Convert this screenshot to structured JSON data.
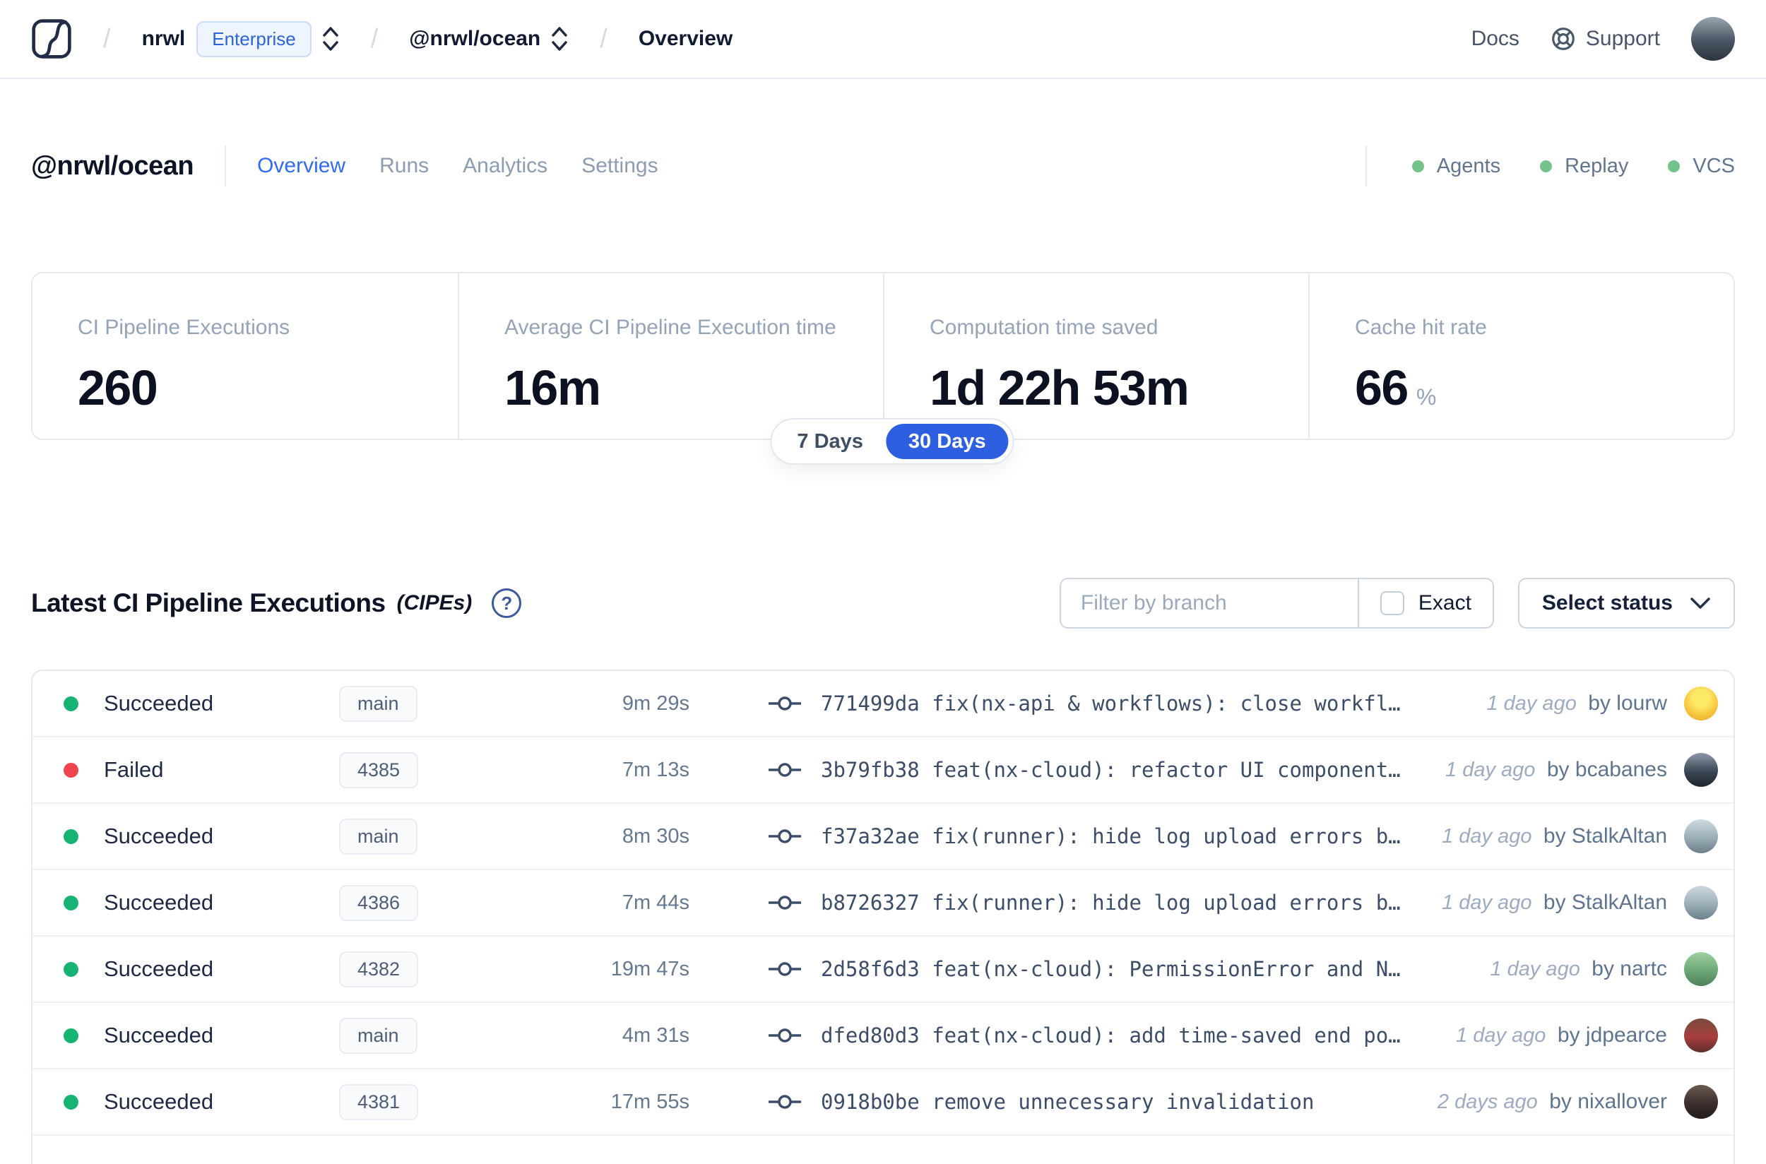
{
  "colors": {
    "accent_blue": "#2e5fe0",
    "success_green": "#16b374",
    "failed_red": "#f2444d",
    "feature_dot_green": "#74c38b"
  },
  "nav": {
    "separator": "/",
    "org": "nrwl",
    "org_badge": "Enterprise",
    "workspace": "@nrwl/ocean",
    "page": "Overview",
    "docs_label": "Docs",
    "support_label": "Support",
    "avatar_bg": "linear-gradient(180deg,#9aa5b1,#4a5563 55%,#2c343f)"
  },
  "workspace": {
    "title": "@nrwl/ocean",
    "tabs": [
      {
        "label": "Overview",
        "active": true
      },
      {
        "label": "Runs",
        "active": false
      },
      {
        "label": "Analytics",
        "active": false
      },
      {
        "label": "Settings",
        "active": false
      }
    ],
    "features": [
      {
        "label": "Agents",
        "dot_color": "#74c38b"
      },
      {
        "label": "Replay",
        "dot_color": "#74c38b"
      },
      {
        "label": "VCS",
        "dot_color": "#74c38b"
      }
    ]
  },
  "stats": {
    "cards": [
      {
        "label": "CI Pipeline Executions",
        "value": "260"
      },
      {
        "label": "Average CI Pipeline Execution time",
        "value": "16m"
      },
      {
        "label": "Computation time saved",
        "value": "1d 22h 53m"
      },
      {
        "label": "Cache hit rate",
        "value": "66",
        "suffix": "%"
      }
    ],
    "range_options": [
      {
        "label": "7 Days",
        "selected": false
      },
      {
        "label": "30 Days",
        "selected": true
      }
    ]
  },
  "cipes": {
    "title": "Latest CI Pipeline Executions",
    "title_suffix": "(CIPEs)",
    "help_glyph": "?",
    "filter": {
      "branch_placeholder": "Filter by branch",
      "exact_label": "Exact",
      "status_button_label": "Select status"
    },
    "rows": [
      {
        "status": "Succeeded",
        "status_color": "#16b374",
        "branch": "main",
        "duration": "9m 29s",
        "commit_hash": "771499da",
        "commit_message": "fix(nx-api & workflows): close workfl…",
        "time_ago": "1 day ago",
        "author": "by lourw",
        "avatar_bg": "radial-gradient(circle at 50% 35%, #fde968 0 30%, #f6c63d 60%, #e3a92a)"
      },
      {
        "status": "Failed",
        "status_color": "#f2444d",
        "branch": "4385",
        "duration": "7m 13s",
        "commit_hash": "3b79fb38",
        "commit_message": "feat(nx-cloud): refactor UI component…",
        "time_ago": "1 day ago",
        "author": "by bcabanes",
        "avatar_bg": "linear-gradient(180deg,#8d99a8,#3c4654 55%,#20262f)"
      },
      {
        "status": "Succeeded",
        "status_color": "#16b374",
        "branch": "main",
        "duration": "8m 30s",
        "commit_hash": "f37a32ae",
        "commit_message": "fix(runner): hide log upload errors b…",
        "time_ago": "1 day ago",
        "author": "by StalkAltan",
        "avatar_bg": "linear-gradient(180deg,#cfd9de,#9fb3bd 50%,#6c7f8a)"
      },
      {
        "status": "Succeeded",
        "status_color": "#16b374",
        "branch": "4386",
        "duration": "7m 44s",
        "commit_hash": "b8726327",
        "commit_message": "fix(runner): hide log upload errors b…",
        "time_ago": "1 day ago",
        "author": "by StalkAltan",
        "avatar_bg": "linear-gradient(180deg,#cfd9de,#9fb3bd 50%,#6c7f8a)"
      },
      {
        "status": "Succeeded",
        "status_color": "#16b374",
        "branch": "4382",
        "duration": "19m 47s",
        "commit_hash": "2d58f6d3",
        "commit_message": "feat(nx-cloud): PermissionError and N…",
        "time_ago": "1 day ago",
        "author": "by nartc",
        "avatar_bg": "linear-gradient(180deg,#9fd0a0,#6da877 55%,#4c7f5a)"
      },
      {
        "status": "Succeeded",
        "status_color": "#16b374",
        "branch": "main",
        "duration": "4m 31s",
        "commit_hash": "dfed80d3",
        "commit_message": "feat(nx-cloud): add time-saved end po…",
        "time_ago": "1 day ago",
        "author": "by jdpearce",
        "avatar_bg": "linear-gradient(180deg,#7a4a3c,#a83f3f 55%,#5d2c2c)"
      },
      {
        "status": "Succeeded",
        "status_color": "#16b374",
        "branch": "4381",
        "duration": "17m 55s",
        "commit_hash": "0918b0be",
        "commit_message": "remove unnecessary invalidation",
        "time_ago": "2 days ago",
        "author": "by nixallover",
        "avatar_bg": "linear-gradient(180deg,#6b5a52,#3a2f2c 55%,#241d1b)"
      }
    ]
  }
}
